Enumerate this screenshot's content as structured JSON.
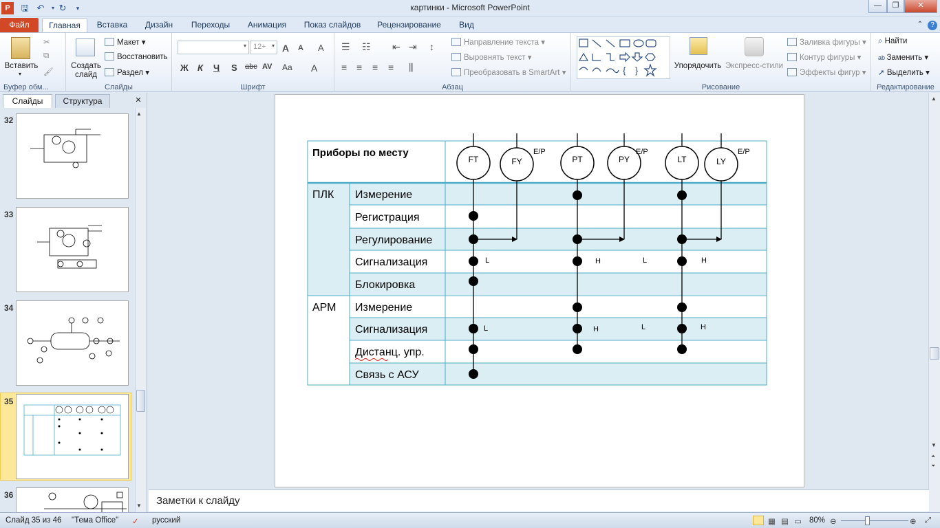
{
  "window": {
    "title": "картинки  -  Microsoft PowerPoint",
    "minimize": "—",
    "maximize": "❐",
    "close": "✕"
  },
  "tabs": [
    "Файл",
    "Главная",
    "Вставка",
    "Дизайн",
    "Переходы",
    "Анимация",
    "Показ слайдов",
    "Рецензирование",
    "Вид"
  ],
  "ribbon": {
    "clipboard": {
      "paste": "Вставить",
      "label": "Буфер обм..."
    },
    "slides": {
      "new_slide": "Создать слайд",
      "layout": "Макет",
      "reset": "Восстановить",
      "section": "Раздел",
      "label": "Слайды"
    },
    "font": {
      "size": "12+",
      "label": "Шрифт",
      "bold": "Ж",
      "italic": "К",
      "underline": "Ч",
      "shadow": "S",
      "strike": "abc",
      "spacing": "AV",
      "case": "Aa",
      "grow": "A",
      "shrink": "A",
      "clear": "A",
      "color": "A"
    },
    "paragraph": {
      "text_dir": "Направление текста",
      "align_text": "Выровнять текст",
      "smartart": "Преобразовать в SmartArt",
      "label": "Абзац"
    },
    "drawing": {
      "arrange": "Упорядочить",
      "quick_styles": "Экспресс-стили",
      "fill": "Заливка фигуры",
      "outline": "Контур фигуры",
      "effects": "Эффекты фигур",
      "label": "Рисование"
    },
    "editing": {
      "find": "Найти",
      "replace": "Заменить",
      "select": "Выделить",
      "label": "Редактирование"
    }
  },
  "panel": {
    "tab_slides": "Слайды",
    "tab_structure": "Структура",
    "close": "✕"
  },
  "thumbnails": [
    "32",
    "33",
    "34",
    "35",
    "36"
  ],
  "selected_thumbnail": "35",
  "slide": {
    "header": "Приборы по месту",
    "instruments": [
      "FT",
      "FY",
      "PT",
      "PY",
      "LT",
      "LY"
    ],
    "converter_label": "E/P",
    "groups": [
      {
        "name": "ПЛК",
        "rows": [
          "Измерение",
          "Регистрация",
          "Регулирование",
          "Сигнализация",
          "Блокировка"
        ]
      },
      {
        "name": "АРМ",
        "rows": [
          "Измерение",
          "Сигнализация",
          "Дистанц.  упр.",
          "Связь с АСУ"
        ]
      }
    ],
    "alarm_low": "L",
    "alarm_high": "H"
  },
  "notes_placeholder": "Заметки к слайду",
  "status": {
    "slide_info": "Слайд 35 из 46",
    "theme": "\"Тема Office\"",
    "language": "русский",
    "zoom": "80%"
  },
  "colors": {
    "table_border": "#4bacc6",
    "band_fill": "#dbeef4",
    "file_tab": "#d24726",
    "selected_thumb": "#fde89a"
  }
}
